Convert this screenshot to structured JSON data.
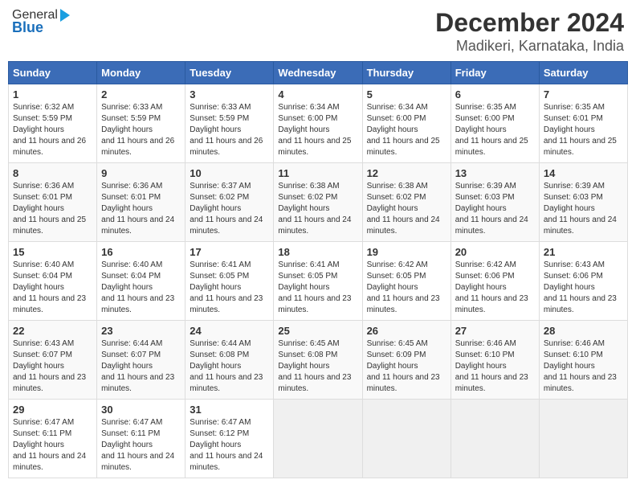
{
  "header": {
    "logo_general": "General",
    "logo_blue": "Blue",
    "month_title": "December 2024",
    "location": "Madikeri, Karnataka, India"
  },
  "calendar": {
    "days_of_week": [
      "Sunday",
      "Monday",
      "Tuesday",
      "Wednesday",
      "Thursday",
      "Friday",
      "Saturday"
    ],
    "weeks": [
      [
        {
          "day": "1",
          "sunrise": "6:32 AM",
          "sunset": "5:59 PM",
          "daylight": "11 hours and 26 minutes."
        },
        {
          "day": "2",
          "sunrise": "6:33 AM",
          "sunset": "5:59 PM",
          "daylight": "11 hours and 26 minutes."
        },
        {
          "day": "3",
          "sunrise": "6:33 AM",
          "sunset": "5:59 PM",
          "daylight": "11 hours and 26 minutes."
        },
        {
          "day": "4",
          "sunrise": "6:34 AM",
          "sunset": "6:00 PM",
          "daylight": "11 hours and 25 minutes."
        },
        {
          "day": "5",
          "sunrise": "6:34 AM",
          "sunset": "6:00 PM",
          "daylight": "11 hours and 25 minutes."
        },
        {
          "day": "6",
          "sunrise": "6:35 AM",
          "sunset": "6:00 PM",
          "daylight": "11 hours and 25 minutes."
        },
        {
          "day": "7",
          "sunrise": "6:35 AM",
          "sunset": "6:01 PM",
          "daylight": "11 hours and 25 minutes."
        }
      ],
      [
        {
          "day": "8",
          "sunrise": "6:36 AM",
          "sunset": "6:01 PM",
          "daylight": "11 hours and 25 minutes."
        },
        {
          "day": "9",
          "sunrise": "6:36 AM",
          "sunset": "6:01 PM",
          "daylight": "11 hours and 24 minutes."
        },
        {
          "day": "10",
          "sunrise": "6:37 AM",
          "sunset": "6:02 PM",
          "daylight": "11 hours and 24 minutes."
        },
        {
          "day": "11",
          "sunrise": "6:38 AM",
          "sunset": "6:02 PM",
          "daylight": "11 hours and 24 minutes."
        },
        {
          "day": "12",
          "sunrise": "6:38 AM",
          "sunset": "6:02 PM",
          "daylight": "11 hours and 24 minutes."
        },
        {
          "day": "13",
          "sunrise": "6:39 AM",
          "sunset": "6:03 PM",
          "daylight": "11 hours and 24 minutes."
        },
        {
          "day": "14",
          "sunrise": "6:39 AM",
          "sunset": "6:03 PM",
          "daylight": "11 hours and 24 minutes."
        }
      ],
      [
        {
          "day": "15",
          "sunrise": "6:40 AM",
          "sunset": "6:04 PM",
          "daylight": "11 hours and 23 minutes."
        },
        {
          "day": "16",
          "sunrise": "6:40 AM",
          "sunset": "6:04 PM",
          "daylight": "11 hours and 23 minutes."
        },
        {
          "day": "17",
          "sunrise": "6:41 AM",
          "sunset": "6:05 PM",
          "daylight": "11 hours and 23 minutes."
        },
        {
          "day": "18",
          "sunrise": "6:41 AM",
          "sunset": "6:05 PM",
          "daylight": "11 hours and 23 minutes."
        },
        {
          "day": "19",
          "sunrise": "6:42 AM",
          "sunset": "6:05 PM",
          "daylight": "11 hours and 23 minutes."
        },
        {
          "day": "20",
          "sunrise": "6:42 AM",
          "sunset": "6:06 PM",
          "daylight": "11 hours and 23 minutes."
        },
        {
          "day": "21",
          "sunrise": "6:43 AM",
          "sunset": "6:06 PM",
          "daylight": "11 hours and 23 minutes."
        }
      ],
      [
        {
          "day": "22",
          "sunrise": "6:43 AM",
          "sunset": "6:07 PM",
          "daylight": "11 hours and 23 minutes."
        },
        {
          "day": "23",
          "sunrise": "6:44 AM",
          "sunset": "6:07 PM",
          "daylight": "11 hours and 23 minutes."
        },
        {
          "day": "24",
          "sunrise": "6:44 AM",
          "sunset": "6:08 PM",
          "daylight": "11 hours and 23 minutes."
        },
        {
          "day": "25",
          "sunrise": "6:45 AM",
          "sunset": "6:08 PM",
          "daylight": "11 hours and 23 minutes."
        },
        {
          "day": "26",
          "sunrise": "6:45 AM",
          "sunset": "6:09 PM",
          "daylight": "11 hours and 23 minutes."
        },
        {
          "day": "27",
          "sunrise": "6:46 AM",
          "sunset": "6:10 PM",
          "daylight": "11 hours and 23 minutes."
        },
        {
          "day": "28",
          "sunrise": "6:46 AM",
          "sunset": "6:10 PM",
          "daylight": "11 hours and 23 minutes."
        }
      ],
      [
        {
          "day": "29",
          "sunrise": "6:47 AM",
          "sunset": "6:11 PM",
          "daylight": "11 hours and 24 minutes."
        },
        {
          "day": "30",
          "sunrise": "6:47 AM",
          "sunset": "6:11 PM",
          "daylight": "11 hours and 24 minutes."
        },
        {
          "day": "31",
          "sunrise": "6:47 AM",
          "sunset": "6:12 PM",
          "daylight": "11 hours and 24 minutes."
        },
        null,
        null,
        null,
        null
      ]
    ]
  }
}
